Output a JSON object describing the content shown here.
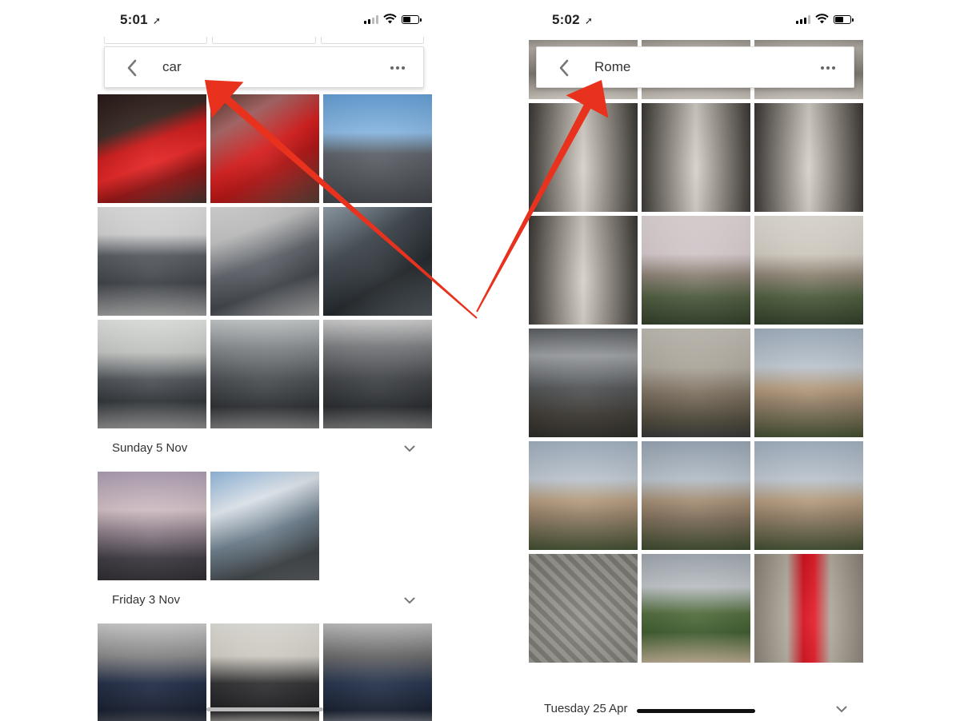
{
  "left": {
    "status": {
      "time": "5:01",
      "battery_level": 0.5
    },
    "search": {
      "query": "car"
    },
    "top_results": [
      {
        "icon": "red-ferrari-photo"
      },
      {
        "icon": "red-ferrari-photo"
      },
      {
        "icon": "city-street-photo"
      },
      {
        "icon": "jeep-compass-rear-photo"
      },
      {
        "icon": "jeep-compass-side-photo"
      },
      {
        "icon": "jeep-interior-photo"
      },
      {
        "icon": "showroom-jeep-photo"
      },
      {
        "icon": "showroom-jeep-front-photo"
      },
      {
        "icon": "showroom-jeep-front-photo"
      }
    ],
    "sections": [
      {
        "title": "Sunday 5 Nov",
        "photos": [
          {
            "icon": "street-dusk-photo"
          },
          {
            "icon": "street-sunny-photo"
          }
        ]
      },
      {
        "title": "Friday 3 Nov",
        "photos": [
          {
            "icon": "land-rover-photo"
          },
          {
            "icon": "land-rover-rear-photo"
          },
          {
            "icon": "land-rover-front-photo"
          }
        ]
      }
    ]
  },
  "right": {
    "status": {
      "time": "5:02",
      "battery_level": 0.6
    },
    "search": {
      "query": "Rome"
    },
    "photos": [
      {
        "icon": "colonnade-photo"
      },
      {
        "icon": "colonnade-photo"
      },
      {
        "icon": "colonnade-photo"
      },
      {
        "icon": "colonnade-photo"
      },
      {
        "icon": "colonnade-photo"
      },
      {
        "icon": "colonnade-photo"
      },
      {
        "icon": "colonnade-photo"
      },
      {
        "icon": "rome-panorama-photo"
      },
      {
        "icon": "rome-panorama-photo"
      },
      {
        "icon": "rome-skyline-photo"
      },
      {
        "icon": "rome-skyline-photo"
      },
      {
        "icon": "rome-skyline-photo"
      },
      {
        "icon": "trajan-market-photo"
      },
      {
        "icon": "trajan-market-photo"
      },
      {
        "icon": "trajan-market-photo"
      },
      {
        "icon": "manhole-cover-photo"
      },
      {
        "icon": "park-photo"
      },
      {
        "icon": "fire-hydrant-photo"
      }
    ],
    "sections": [
      {
        "title": "Tuesday 25 Apr"
      }
    ]
  },
  "annotation": {
    "arrow_color": "#e8321e",
    "icon": "red-arrow"
  }
}
